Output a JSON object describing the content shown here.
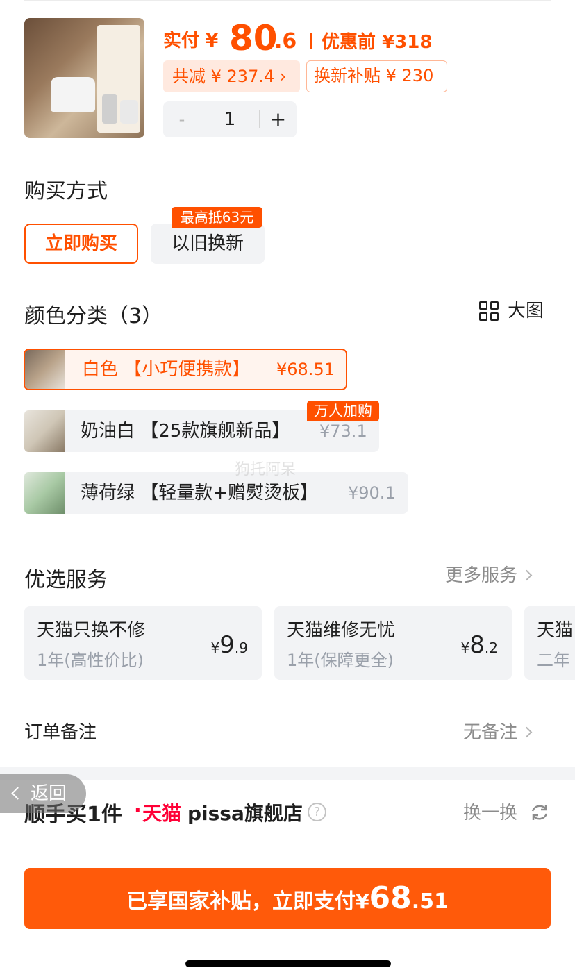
{
  "product": {
    "paid_label": "实付",
    "paid_currency": "¥",
    "paid_int": "80",
    "paid_dec": ".6",
    "before_price": "优惠前 ¥318",
    "total_saving": "共减 ¥ 237.4 ›",
    "trade_in_subsidy": "换新补贴 ¥ 230",
    "quantity": {
      "minus": "-",
      "value": "1",
      "plus": "+"
    }
  },
  "purchase_method": {
    "title": "购买方式",
    "options": [
      {
        "label": "立即购买",
        "selected": true
      },
      {
        "label": "以旧换新",
        "selected": false,
        "tag": "最高抵63元"
      }
    ]
  },
  "color_category": {
    "title": "颜色分类（3）",
    "big_image_label": "大图",
    "options": [
      {
        "label": "白色 【小巧便携款】",
        "price": "¥68.51",
        "selected": true
      },
      {
        "label": "奶油白 【25款旗舰新品】",
        "price": "¥73.1",
        "selected": false,
        "tag": "万人加购"
      },
      {
        "label": "薄荷绿 【轻量款+赠熨烫板】",
        "price": "¥90.1",
        "selected": false
      }
    ]
  },
  "watermark": "狗托阿呆",
  "services": {
    "title": "优选服务",
    "more_label": "更多服务",
    "cards": [
      {
        "name": "天猫只换不修",
        "desc": "1年(高性价比)",
        "price_symbol": "¥",
        "price_int": "9",
        "price_dec": ".9"
      },
      {
        "name": "天猫维修无忧",
        "desc": "1年(保障更全)",
        "price_symbol": "¥",
        "price_int": "8",
        "price_dec": ".2"
      },
      {
        "name": "天猫",
        "desc": "二年"
      }
    ]
  },
  "order_note": {
    "label": "订单备注",
    "value": "无备注"
  },
  "buy_more": {
    "title": "顺手买1件",
    "dot": "·",
    "platform": "天猫",
    "store": "pissa旗舰店",
    "help": "?",
    "swap_label": "换一换"
  },
  "back_label": "返回",
  "pay_button": {
    "text": "已享国家补贴，立即支付",
    "currency": "¥",
    "int": "68",
    "dec": ".51"
  },
  "colors": {
    "accent": "#ff5000",
    "pay_button": "#ff5a0a",
    "tmall_red": "#ff0036",
    "chip_bg": "#f2f3f5"
  }
}
